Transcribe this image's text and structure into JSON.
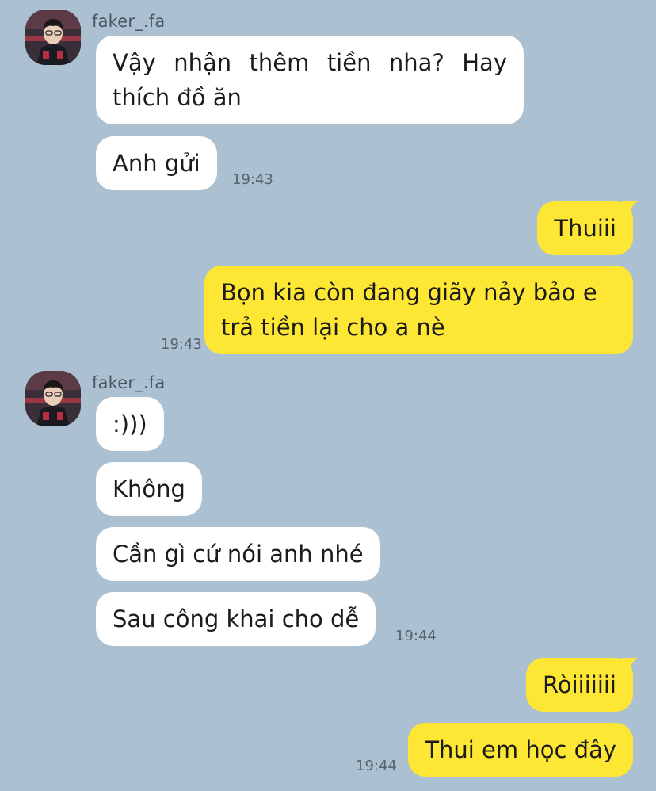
{
  "chat": {
    "sender_name": "faker_.fa",
    "avatar_icon": "profile-photo",
    "colors": {
      "background": "#abc1d1",
      "incoming_bubble": "#ffffff",
      "outgoing_bubble": "#fde734"
    },
    "group1": {
      "sender": "faker_.fa",
      "messages": [
        "Vậy nhận thêm tiền nha? Hay thích đồ ăn",
        "Anh gửi"
      ],
      "time": "19:43"
    },
    "group2": {
      "messages": [
        "Thuiii",
        "Bọn kia còn đang giãy nảy bảo e trả tiền lại cho a nè"
      ],
      "time": "19:43"
    },
    "group3": {
      "sender": "faker_.fa",
      "messages": [
        ":)))",
        "Không",
        "Cần gì cứ nói anh nhé",
        "Sau công khai cho dễ"
      ],
      "time": "19:44"
    },
    "group4": {
      "messages": [
        "Ròiiiiiii",
        "Thui em học đây"
      ],
      "time": "19:44"
    }
  }
}
